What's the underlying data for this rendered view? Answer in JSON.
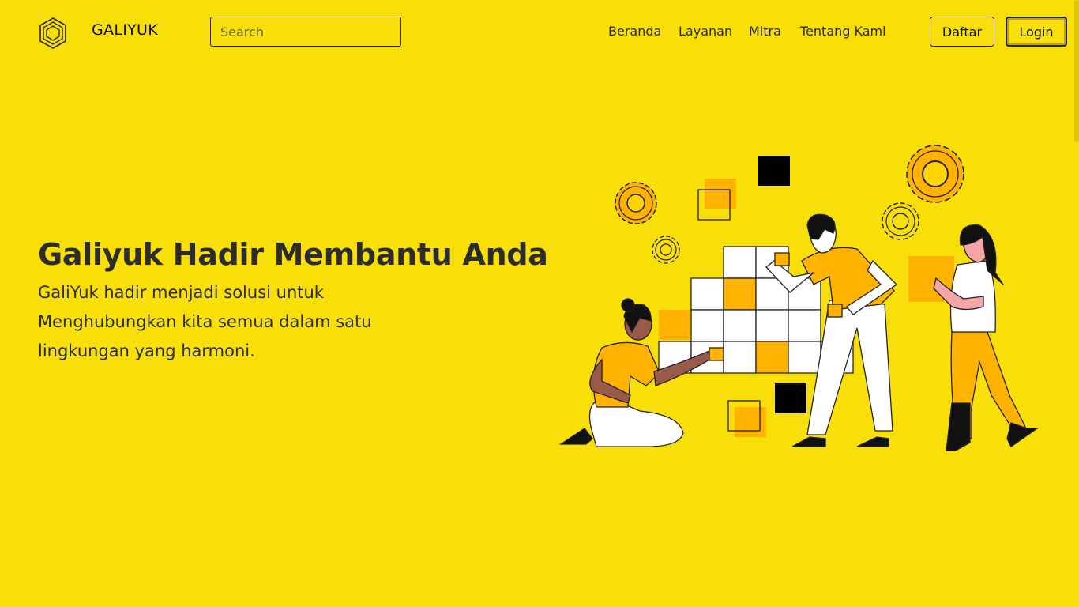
{
  "navbar": {
    "brand": "GALIYUK",
    "logo_icon": "hexagon-logo-icon",
    "search_placeholder": "Search",
    "links": [
      "Beranda",
      "Layanan",
      "Mitra",
      "Tentang Kami"
    ],
    "register_label": "Daftar",
    "login_label": "Login"
  },
  "hero": {
    "title": "Galiyuk Hadir Membantu Anda",
    "description": "GaliYuk hadir menjadi solusi untuk Menghubungkan kita semua dalam satu lingkungan yang harmoni.",
    "illustration": "team-building-blocks-illustration"
  },
  "colors": {
    "background": "#f8df09",
    "accent_orange": "#ffb300",
    "text_dark": "#2c2c2c",
    "skin_dark": "#9a5a4a",
    "skin_light": "#f4a6a6"
  }
}
